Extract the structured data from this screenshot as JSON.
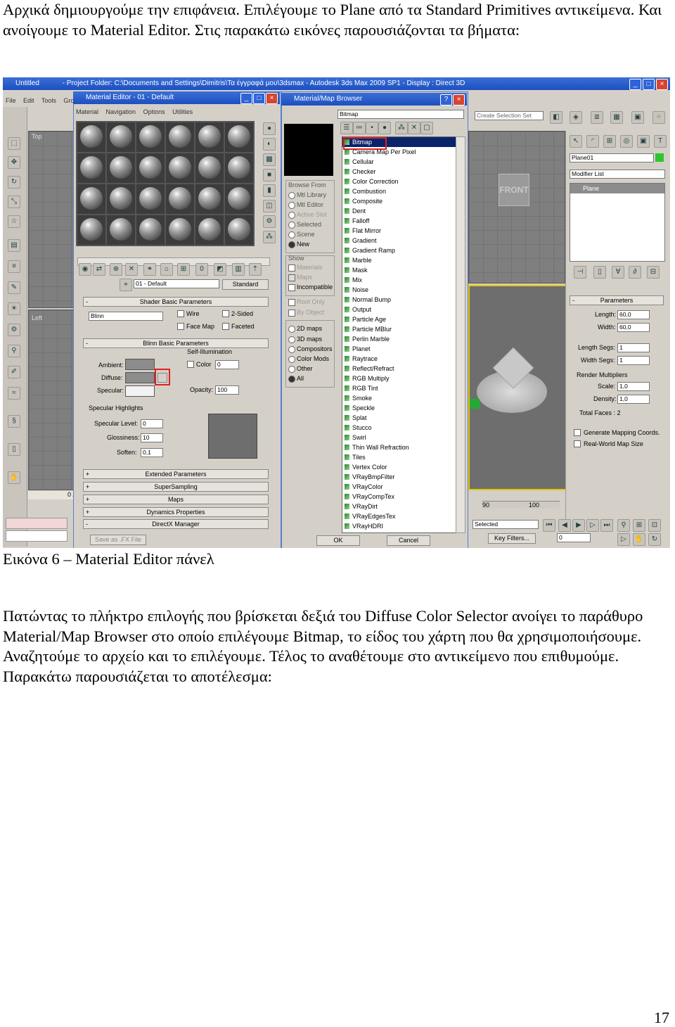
{
  "intro_text": "Αρχικά δημιουργούμε την επιφάνεια. Επιλέγουμε το Plane από τα Standard Primitives αντικείμενα. Και ανοίγουμε το Material Editor. Στις παρακάτω εικόνες παρουσιάζονται τα βήματα:",
  "caption": "Εικόνα 6 – Material Editor πάνελ",
  "body_text": "Πατώντας το πλήκτρο επιλογής που βρίσκεται δεξιά του Diffuse Color Selector ανοίγει το παράθυρο Material/Map Browser στο οποίο επιλέγουμε Bitmap, το είδος του χάρτη που θα χρησιμοποιήσουμε. Αναζητούμε το αρχείο και το επιλέγουμε. Τέλος το αναθέτουμε στο αντικείμενο που επιθυμούμε. Παρακάτω παρουσιάζεται το αποτέλεσμα:",
  "page_number": "17",
  "screenshot": {
    "max_title": "Untitled",
    "max_title_path": "- Project Folder: C:\\Documents and Settings\\Dimitris\\Τα έγγραφά μου\\3dsmax - Autodesk 3ds Max 2009 SP1 - Display : Direct 3D",
    "max_menu": [
      "File",
      "Edit",
      "Tools",
      "Gro"
    ],
    "viewport_top": "Top",
    "viewport_left": "Left",
    "viewport_front_label": "FRONT",
    "mat_editor": {
      "title": "Material Editor - 01 - Default",
      "menu": [
        "Material",
        "Navigation",
        "Options",
        "Utilities"
      ],
      "material_name": "01 - Default",
      "material_type": "Standard",
      "shader_rollout": "Shader Basic Parameters",
      "shader": "Blinn",
      "wire": "Wire",
      "two_sided": "2-Sided",
      "face_map": "Face Map",
      "faceted": "Faceted",
      "blinn_rollout": "Blinn Basic Parameters",
      "self_illum": "Self-Illumination",
      "ambient": "Ambient:",
      "diffuse": "Diffuse:",
      "specular": "Specular:",
      "color": "Color",
      "color_val": "0",
      "opacity": "Opacity:",
      "opacity_val": "100",
      "spec_highlights": "Specular Highlights",
      "spec_level": "Specular Level:",
      "spec_level_val": "0",
      "glossiness": "Glossiness:",
      "glossiness_val": "10",
      "soften": "Soften:",
      "soften_val": "0,1",
      "rollouts": [
        "Extended Parameters",
        "SuperSampling",
        "Maps",
        "Dynamics Properties",
        "DirectX Manager"
      ],
      "save_fx": "Save as .FX File"
    },
    "browser": {
      "title": "Material/Map Browser",
      "name_field": "Bitmap",
      "browse_from": "Browse From",
      "browse_options": [
        "Mtl Library",
        "Mtl Editor",
        "Active Slot",
        "Selected",
        "Scene",
        "New"
      ],
      "show": "Show",
      "show_options": [
        "Materials",
        "Maps",
        "Incompatible"
      ],
      "root_only": "Root Only",
      "by_object": "By Object",
      "map_types": [
        "2D maps",
        "3D maps",
        "Compositors",
        "Color Mods",
        "Other",
        "All"
      ],
      "maps": [
        "Bitmap",
        "Camera Map Per Pixel",
        "Cellular",
        "Checker",
        "Color Correction",
        "Combustion",
        "Composite",
        "Dent",
        "Falloff",
        "Flat Mirror",
        "Gradient",
        "Gradient Ramp",
        "Marble",
        "Mask",
        "Mix",
        "Noise",
        "Normal Bump",
        "Output",
        "Particle Age",
        "Particle MBlur",
        "Perlin Marble",
        "Planet",
        "Raytrace",
        "Reflect/Refract",
        "RGB Multiply",
        "RGB Tint",
        "Smoke",
        "Speckle",
        "Splat",
        "Stucco",
        "Swirl",
        "Thin Wall Refraction",
        "Tiles",
        "Vertex Color",
        "VRayBmpFilter",
        "VRayColor",
        "VRayCompTex",
        "VRayDirt",
        "VRayEdgesTex",
        "VRayHDRI"
      ],
      "ok": "OK",
      "cancel": "Cancel"
    },
    "command_panel": {
      "selection_set": "Create Selection Set",
      "object_name": "Plane01",
      "modifier_list": "Modifier List",
      "stack_item": "Plane",
      "parameters": "Parameters",
      "length": "Length:",
      "length_val": "60,0",
      "width": "Width:",
      "width_val": "60,0",
      "length_segs": "Length Segs:",
      "length_segs_val": "1",
      "width_segs": "Width Segs:",
      "width_segs_val": "1",
      "render_multipliers": "Render Multipliers",
      "scale": "Scale:",
      "scale_val": "1,0",
      "density": "Density:",
      "density_val": "1,0",
      "total_faces": "Total Faces : 2",
      "gen_mapping": "Generate Mapping Coords.",
      "real_world": "Real-World Map Size"
    },
    "status": {
      "selected": "Selected",
      "key_filters": "Key Filters...",
      "frame": "0",
      "tick_90": "90",
      "tick_100": "100",
      "slider": "0 /"
    }
  }
}
